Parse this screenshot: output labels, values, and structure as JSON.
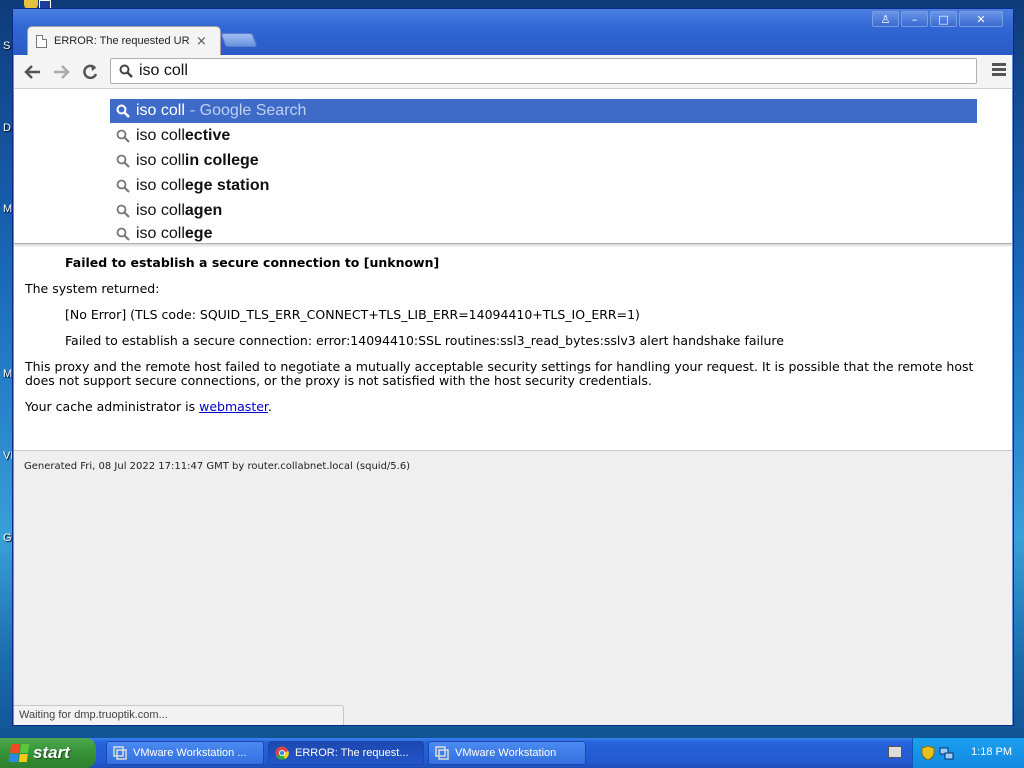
{
  "desktop": {
    "letters": [
      "S",
      "D",
      "M",
      "M",
      "VI",
      "G"
    ]
  },
  "window": {
    "controls": {
      "help": "♙",
      "minimize": "–",
      "maximize": "□",
      "close": "✕"
    }
  },
  "tab": {
    "title": "ERROR: The requested URL",
    "close": "×"
  },
  "omnibox": {
    "value": "iso coll"
  },
  "suggestions": [
    {
      "prefix": "iso coll",
      "rest": "",
      "hint": "- Google Search"
    },
    {
      "prefix": "iso coll",
      "rest": "ective",
      "hint": ""
    },
    {
      "prefix": "iso coll",
      "rest": "in college",
      "hint": ""
    },
    {
      "prefix": "iso coll",
      "rest": "ege station",
      "hint": ""
    },
    {
      "prefix": "iso coll",
      "rest": "agen",
      "hint": ""
    },
    {
      "prefix": "iso coll",
      "rest": "ege",
      "hint": ""
    }
  ],
  "error": {
    "title": "Failed to establish a secure connection to [unknown]",
    "system_returned": "The system returned:",
    "no_error": "[No Error] (TLS code: SQUID_TLS_ERR_CONNECT+TLS_LIB_ERR=14094410+TLS_IO_ERR=1)",
    "detail": "Failed to establish a secure connection: error:14094410:SSL routines:ssl3_read_bytes:sslv3 alert handshake failure",
    "paragraph_line1": "This proxy and the remote host failed to negotiate a mutually acceptable security settings for handling your request. It is possible that the remote host",
    "paragraph_line2": "does not support secure connections, or the proxy is not satisfied with the host security credentials.",
    "admin_prefix": "Your cache administrator is ",
    "admin_link": "webmaster",
    "admin_suffix": "."
  },
  "footer": {
    "generated": "Generated Fri, 08 Jul 2022 17:11:47 GMT by router.collabnet.local (squid/5.6)"
  },
  "status_bar": {
    "text": "Waiting for dmp.truoptik.com..."
  },
  "taskbar": {
    "start_label": "start",
    "tasks": [
      {
        "label": "VMware Workstation ...",
        "active": false
      },
      {
        "label": "ERROR: The request...",
        "active": true
      },
      {
        "label": "VMware Workstation",
        "active": false
      }
    ],
    "clock": "1:18 PM"
  },
  "colors": {
    "selection": "#3f6bc8",
    "link": "#0000cc",
    "taskbar": "#235ad0",
    "start": "#3a963a"
  }
}
